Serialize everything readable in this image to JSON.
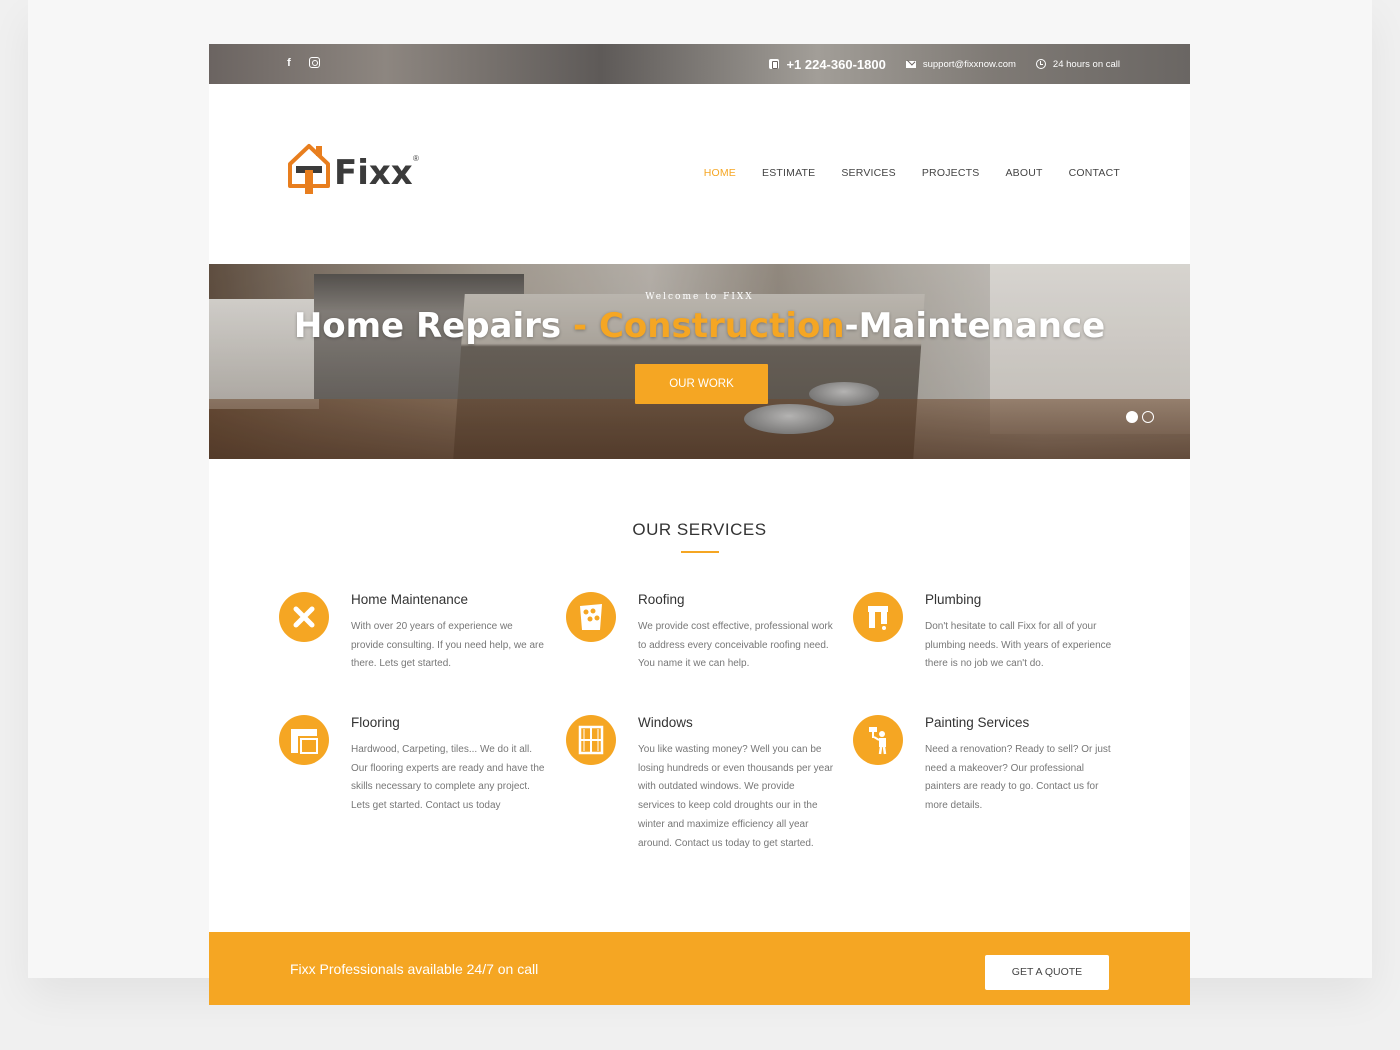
{
  "topbar": {
    "phone": "+1 224-360-1800",
    "email": "support@fixxnow.com",
    "hours": "24 hours on call",
    "social_icons": [
      "facebook-icon",
      "instagram-icon"
    ]
  },
  "brand": {
    "name": "Fixx",
    "reg_mark": "®",
    "accent_color": "#f5a623"
  },
  "nav": {
    "items": [
      {
        "label": "HOME",
        "active": true
      },
      {
        "label": "ESTIMATE",
        "active": false
      },
      {
        "label": "SERVICES",
        "active": false
      },
      {
        "label": "PROJECTS",
        "active": false
      },
      {
        "label": "ABOUT",
        "active": false
      },
      {
        "label": "CONTACT",
        "active": false
      }
    ]
  },
  "hero": {
    "welcome": "Welcome to FIXX",
    "title_part1": "Home Repairs",
    "title_sep1": " - ",
    "title_part2": "Construction",
    "title_part3": "-Maintenance",
    "button": "OUR WORK",
    "slides": 2,
    "active_slide": 1
  },
  "services": {
    "heading": "OUR SERVICES",
    "items": [
      {
        "title": "Home Maintenance",
        "icon": "tools-icon",
        "text": "With over 20 years of experience we provide consulting. If you need help, we are there. Lets get started."
      },
      {
        "title": "Roofing",
        "icon": "roof-tiles-icon",
        "text": "We provide cost effective, professional work to address every conceivable roofing need. You name it we can help."
      },
      {
        "title": "Plumbing",
        "icon": "faucet-icon",
        "text": "Don't hesitate to call Fixx for all of your plumbing needs. With years of experience there is no job we can't do."
      },
      {
        "title": "Flooring",
        "icon": "flooring-icon",
        "text": "Hardwood, Carpeting, tiles... We do it all. Our flooring experts are ready and have the skills necessary to complete any project. Lets get started. Contact us today"
      },
      {
        "title": "Windows",
        "icon": "window-icon",
        "text": "You like wasting money? Well you can be losing hundreds or even thousands per year with outdated windows. We provide services to keep cold droughts our in the winter and maximize efficiency all year around. Contact us today to get started."
      },
      {
        "title": "Painting Services",
        "icon": "painter-icon",
        "text": "Need a renovation? Ready to sell? Or just need a makeover? Our professional painters are ready to go. Contact us for more details."
      }
    ]
  },
  "cta": {
    "text": "Fixx Professionals available 24/7 on call",
    "button": "GET A QUOTE"
  }
}
